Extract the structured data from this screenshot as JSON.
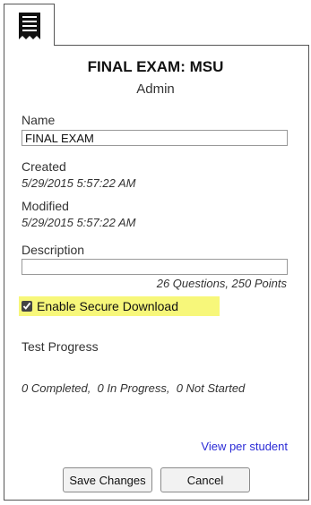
{
  "tab": {
    "icon": "document-list-icon"
  },
  "header": {
    "title": "FINAL EXAM: MSU",
    "subtitle": "Admin"
  },
  "fields": {
    "name_label": "Name",
    "name_value": "FINAL EXAM",
    "created_label": "Created",
    "created_value": "5/29/2015 5:57:22 AM",
    "modified_label": "Modified",
    "modified_value": "5/29/2015 5:57:22 AM",
    "description_label": "Description",
    "description_value": ""
  },
  "summary": "26 Questions, 250 Points",
  "secure_download": {
    "label": "Enable Secure Download",
    "checked": true,
    "highlight": "#f7f77a"
  },
  "progress": {
    "label": "Test Progress",
    "values": "0 Completed,  0 In Progress,  0 Not Started"
  },
  "link": "View per student",
  "buttons": {
    "save": "Save Changes",
    "cancel": "Cancel"
  },
  "colors": {
    "link": "#2b2bd6"
  }
}
